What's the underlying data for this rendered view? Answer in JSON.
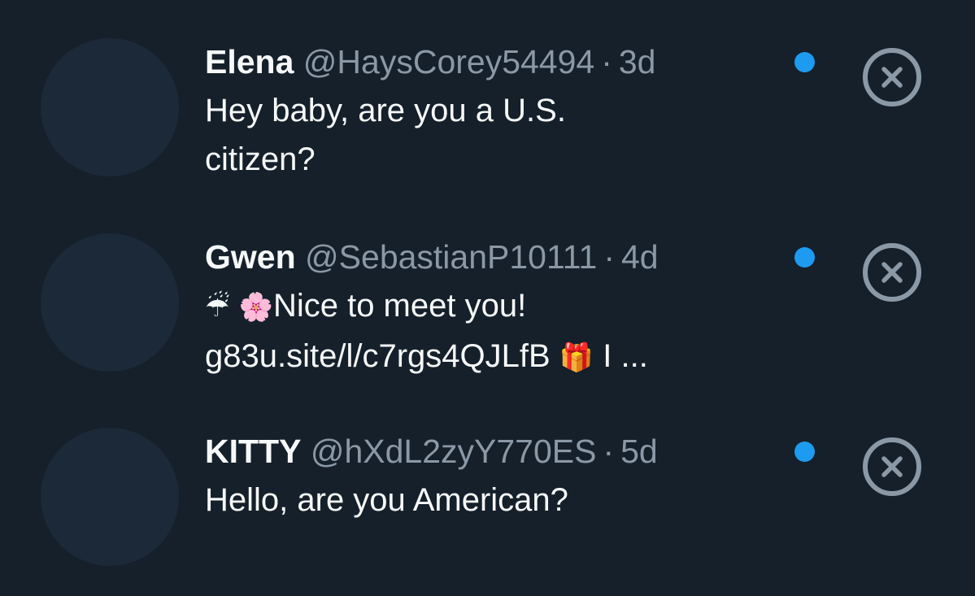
{
  "colors": {
    "background": "#15202b",
    "avatar_placeholder": "#1c2938",
    "text_primary": "#f7f9f9",
    "text_secondary": "#8b98a5",
    "unread_dot": "#1d9bf0"
  },
  "separator": "·",
  "messages": [
    {
      "name": "Elena",
      "handle": "@HaysCorey54494",
      "time": "3d",
      "text_line1": "Hey baby, are you a U.S.",
      "text_line2": "citizen?",
      "unread": true
    },
    {
      "name": "Gwen",
      "handle": "@SebastianP10111",
      "time": "4d",
      "emoji_umbrella": "☔",
      "emoji_blossom": "🌸",
      "text_line1": "Nice to meet you!",
      "text_line2": "g83u.site/l/c7rgs4QJLfB",
      "emoji_gift": "🎁",
      "text_tail": "I ...",
      "unread": true
    },
    {
      "name": "KITTY",
      "handle": "@hXdL2zyY770ES",
      "time": "5d",
      "text_line1": "Hello, are you American?",
      "unread": true
    }
  ]
}
